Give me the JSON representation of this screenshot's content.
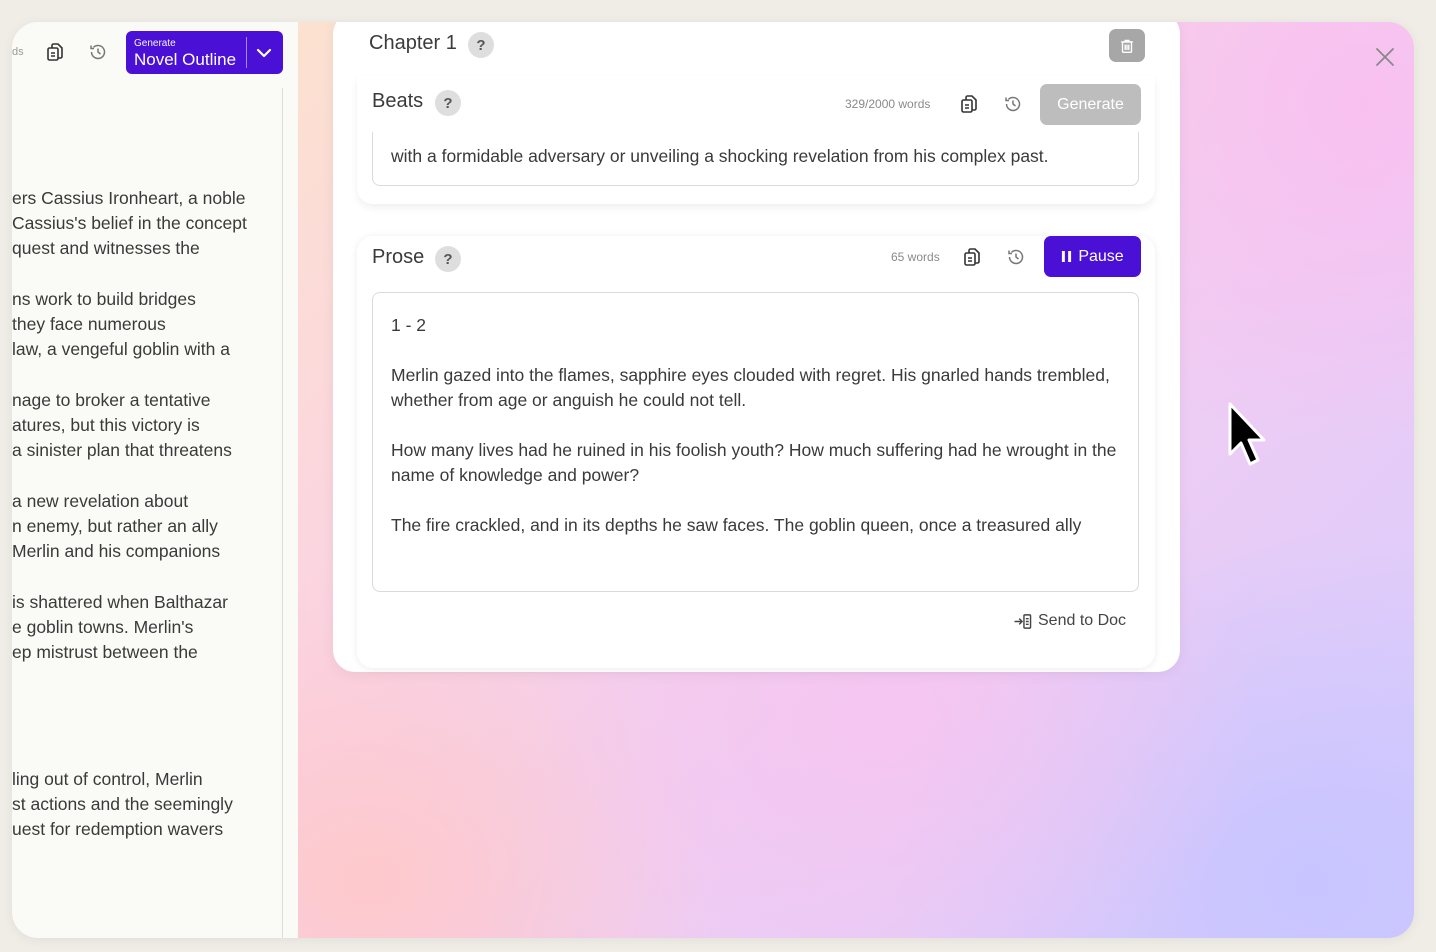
{
  "left_panel": {
    "toolbar_label": "ds",
    "generate_small": "Generate",
    "generate_main": "Novel Outline",
    "paragraphs": [
      [
        "ers Cassius Ironheart, a noble",
        "Cassius's belief in the concept",
        "quest and witnesses the"
      ],
      [
        "ns work to build bridges",
        " they face numerous",
        "law, a vengeful goblin with a"
      ],
      [
        "nage to broker a tentative",
        "atures, but this victory is",
        " a sinister plan that threatens"
      ],
      [
        " a new revelation about",
        "n enemy, but rather an ally",
        " Merlin and his companions"
      ],
      [
        "is shattered when Balthazar",
        "e goblin towns. Merlin's",
        "ep mistrust between the"
      ],
      [
        "",
        "",
        ""
      ],
      [
        "ling out of control, Merlin",
        "st actions and the seemingly",
        "uest for redemption wavers"
      ]
    ]
  },
  "chapter": {
    "title": "Chapter 1",
    "help": "?"
  },
  "beats": {
    "title": "Beats",
    "help": "?",
    "word_count": "329/2000 words",
    "generate_label": "Generate",
    "text": "with a formidable adversary or unveiling a shocking revelation from his complex past."
  },
  "prose": {
    "title": "Prose",
    "help": "?",
    "word_count": "65 words",
    "pause_label": "Pause",
    "paragraphs": [
      "1 - 2",
      "Merlin gazed into the flames, sapphire eyes clouded with regret. His gnarled hands trembled, whether from age or anguish he could not tell.",
      "How many lives had he ruined in his foolish youth? How much suffering had he wrought in the name of knowledge and power?",
      "The fire crackled, and in its depths he saw faces. The goblin queen, once a treasured ally"
    ],
    "send_to_doc": "Send to Doc"
  },
  "colors": {
    "accent": "#4a10d6",
    "disabled_button": "#bdbdbd",
    "trash_button": "#a7a7a7"
  },
  "icons": [
    "copy-icon",
    "history-icon",
    "chevron-down-icon",
    "trash-icon",
    "help-icon",
    "pause-icon",
    "send-to-doc-icon",
    "close-icon",
    "mouse-cursor-icon"
  ]
}
